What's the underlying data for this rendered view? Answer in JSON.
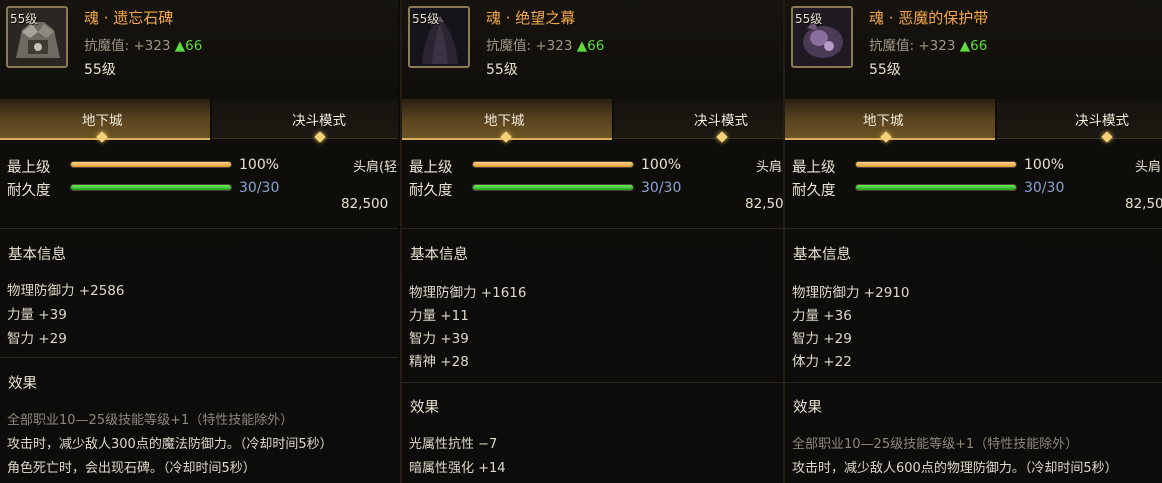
{
  "panels": [
    {
      "icon": "armor-shoulder-icon",
      "level_badge": "55级",
      "name": "魂 · 遗忘石碑",
      "stat_label": "抗魔值: +323",
      "stat_up": "▲66",
      "level": "55级",
      "tab_dungeon": "地下城",
      "tab_duel": "决斗模式",
      "grade_label": "最上级",
      "grade_value": "100%",
      "grade_fill": 1.0,
      "durability_label": "耐久度",
      "durability_value": "30/30",
      "durability_fill": 1.0,
      "side_label": "头肩(轻",
      "side_price": "82,500",
      "basic_title": "基本信息",
      "attrs": [
        "物理防御力 +2586",
        "力量 +39",
        "智力 +29"
      ],
      "effect_title": "效果",
      "effects": [
        "全部职业10—25级技能等级+1（特性技能除外）",
        "攻击时，减少敌人300点的魔法防御力。（冷却时间5秒）",
        "角色死亡时，会出现石碑。（冷却时间5秒）"
      ]
    },
    {
      "icon": "dark-cloak-icon",
      "level_badge": "55级",
      "name": "魂 · 绝望之幕",
      "stat_label": "抗魔值: +323",
      "stat_up": "▲66",
      "level": "55级",
      "tab_dungeon": "地下城",
      "tab_duel": "决斗模式",
      "grade_label": "最上级",
      "grade_value": "100%",
      "grade_fill": 1.0,
      "durability_label": "耐久度",
      "durability_value": "30/30",
      "durability_fill": 1.0,
      "side_label": "头肩",
      "side_price": "82,50",
      "basic_title": "基本信息",
      "attrs": [
        "物理防御力 +1616",
        "力量 +11",
        "智力 +39",
        "精神 +28"
      ],
      "effect_title": "效果",
      "effects": [
        "光属性抗性 −7",
        "暗属性强化 +14"
      ]
    },
    {
      "icon": "demon-belt-icon",
      "level_badge": "55级",
      "name": "魂 · 恶魔的保护带",
      "stat_label": "抗魔值: +323",
      "stat_up": "▲66",
      "level": "55级",
      "tab_dungeon": "地下城",
      "tab_duel": "决斗模式",
      "grade_label": "最上级",
      "grade_value": "100%",
      "grade_fill": 1.0,
      "durability_label": "耐久度",
      "durability_value": "30/30",
      "durability_fill": 1.0,
      "side_label": "头肩",
      "side_price": "82,50",
      "basic_title": "基本信息",
      "attrs": [
        "物理防御力 +2910",
        "力量 +36",
        "智力 +29",
        "体力 +22"
      ],
      "effect_title": "效果",
      "effects": [
        "全部职业10—25级技能等级+1（特性技能除外）",
        "攻击时，减少敌人600点的物理防御力。（冷却时间5秒）"
      ]
    }
  ]
}
